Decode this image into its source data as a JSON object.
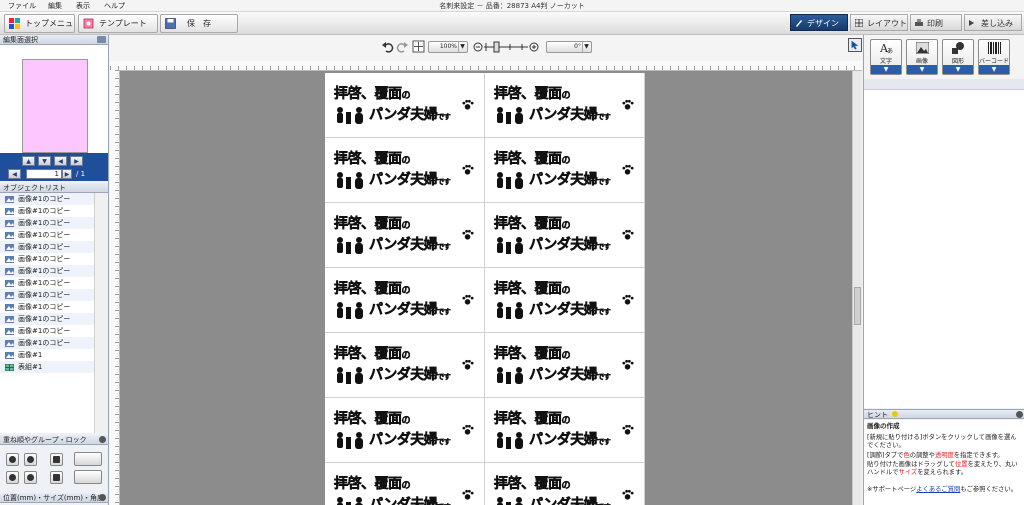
{
  "menubar": {
    "items": [
      "ファイル",
      "編集",
      "表示",
      "ヘルプ"
    ],
    "title": "名刺来設定 － 品番：28873 A4判 ノーカット"
  },
  "toolbar": {
    "top_menu": "トップメニュー",
    "template": "テンプレート",
    "save": "保　存"
  },
  "steps": [
    "デザイン",
    "レイアウト",
    "印刷",
    "差し込み"
  ],
  "left": {
    "page_select_title": "編集面選択",
    "page_number": "1",
    "page_total": "/ 1",
    "objectlist_title": "オブジェクトリスト",
    "objects": [
      "画像#1のコピー",
      "画像#1のコピー",
      "画像#1のコピー",
      "画像#1のコピー",
      "画像#1のコピー",
      "画像#1のコピー",
      "画像#1のコピー",
      "画像#1のコピー",
      "画像#1のコピー",
      "画像#1のコピー",
      "画像#1のコピー",
      "画像#1のコピー",
      "画像#1のコピー",
      "画像#1",
      "表組#1"
    ],
    "lock_title": "重ね順やグループ・ロック",
    "pos_title": "位置(mm)・サイズ(mm)・角度"
  },
  "canvas": {
    "zoom": "100%",
    "angle": "0°",
    "card_line1": "拝啓、覆面",
    "card_line1_small": "の",
    "card_line2": "パンダ夫婦",
    "card_line2_small": "です",
    "cards": 14
  },
  "right": {
    "tools": [
      "文字",
      "画像",
      "図形",
      "バーコード"
    ],
    "hint_title": "ヒント",
    "hint_heading": "画像の作成",
    "hint_p1": "[新規に貼り付ける]ボタンをクリックして画像を選んでください。",
    "hint_p2_a": "[調節]タブで",
    "hint_p2_b": "色",
    "hint_p2_c": "の調整や",
    "hint_p2_d": "透明度",
    "hint_p2_e": "を指定できます。",
    "hint_p3_a": "貼り付けた画像はドラッグして",
    "hint_p3_b": "位置",
    "hint_p3_c": "を変えたり、丸いハンドルで",
    "hint_p3_d": "サイズ",
    "hint_p3_e": "を変えられます。",
    "hint_p4_a": "※サポートページ",
    "hint_p4_link": "よくあるご質問",
    "hint_p4_b": "もご参照ください。"
  },
  "colors": {
    "accent": "#1f4f9a",
    "thumb": "#fcc7ff",
    "workarea": "#8c8c8c",
    "hint_red": "#e02020"
  }
}
